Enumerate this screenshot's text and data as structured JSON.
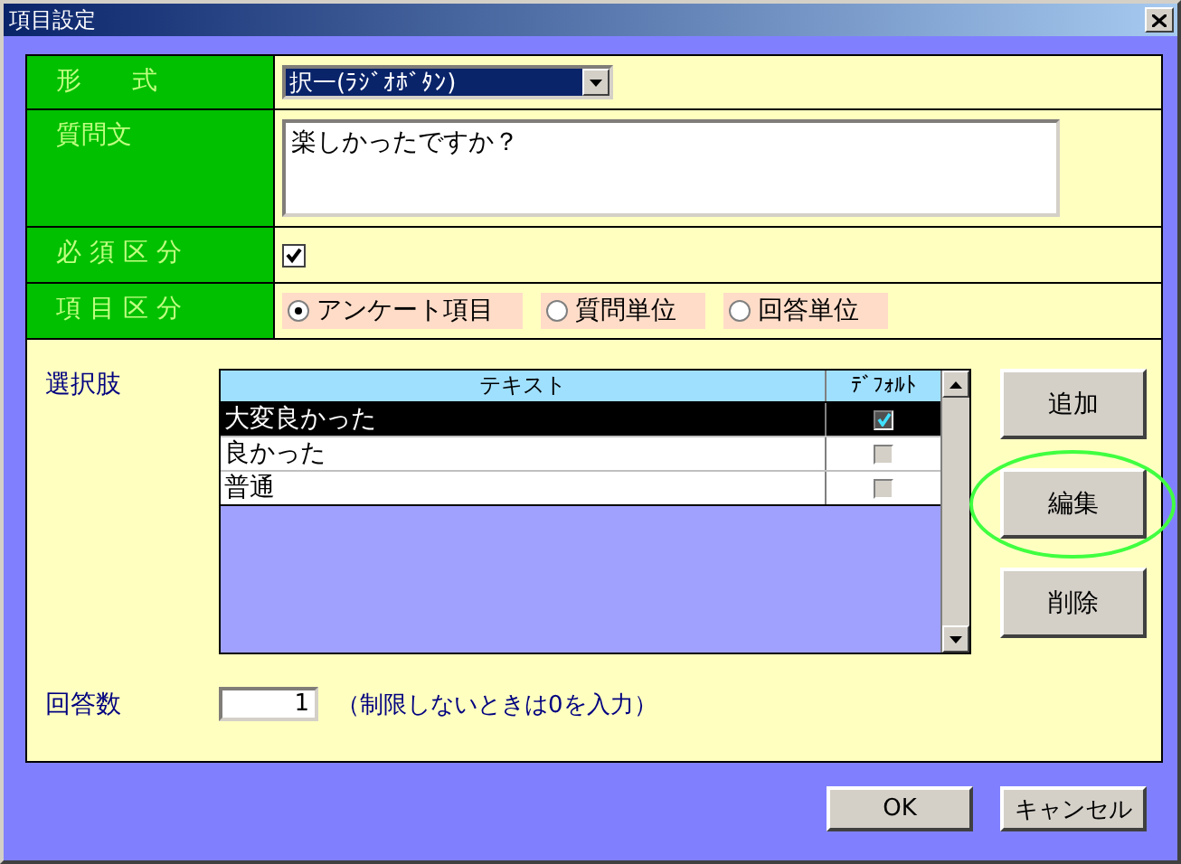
{
  "window": {
    "title": "項目設定"
  },
  "form": {
    "format": {
      "label": "形　　式",
      "value": "択一(ﾗｼﾞｵﾎﾞﾀﾝ)",
      "value_selected": true
    },
    "question": {
      "label": "質問文",
      "value": "楽しかったですか？"
    },
    "required": {
      "label": "必 須 区 分",
      "checked": true
    },
    "item_type": {
      "label": "項 目 区 分",
      "options": [
        {
          "label": "アンケート項目",
          "selected": true
        },
        {
          "label": "質問単位",
          "selected": false
        },
        {
          "label": "回答単位",
          "selected": false
        }
      ]
    }
  },
  "choices": {
    "label": "選択肢",
    "columns": [
      "テキスト",
      "ﾃﾞﾌｫﾙﾄ"
    ],
    "rows": [
      {
        "text": "大変良かった",
        "default": true,
        "selected": true
      },
      {
        "text": "良かった",
        "default": false,
        "selected": false
      },
      {
        "text": "普通",
        "default": false,
        "selected": false
      }
    ],
    "buttons": [
      {
        "label": "追加",
        "highlighted": false
      },
      {
        "label": "編集",
        "highlighted": true
      },
      {
        "label": "削除",
        "highlighted": false
      }
    ]
  },
  "answer_count": {
    "label": "回答数",
    "value": "1",
    "hint": "（制限しないときは0を入力）"
  },
  "buttons": [
    "OK",
    "キャンセル"
  ]
}
